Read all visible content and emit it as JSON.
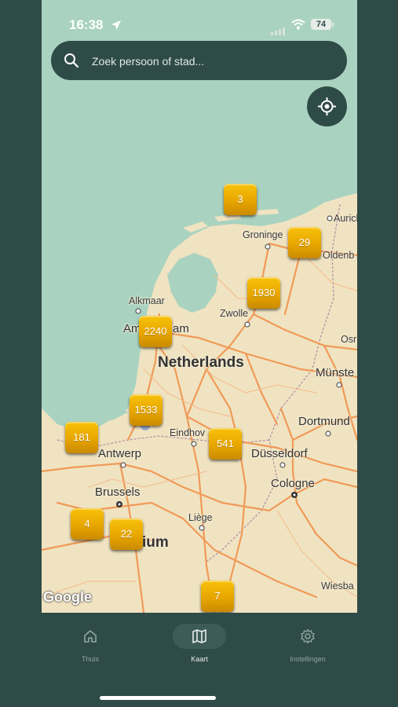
{
  "status_bar": {
    "time": "16:38",
    "battery": "74"
  },
  "search": {
    "placeholder": "Zoek persoon of stad..."
  },
  "map": {
    "attribution": "Google",
    "country_labels": {
      "netherlands": "Netherlands",
      "belgium_partial": "ium"
    },
    "city_labels": {
      "aurich": "Aurich",
      "groningen": "Groninge",
      "oldenburg": "Oldenb",
      "alkmaar": "Alkmaar",
      "amsterdam_left": "Am",
      "amsterdam_right": "am",
      "zwolle": "Zwolle",
      "osnabruck": "Osr",
      "munster": "Münste",
      "dortmund": "Dortmund",
      "eindhoven": "Eindhov",
      "antwerp": "Antwerp",
      "dusseldorf": "Düsseldorf",
      "cologne": "Cologne",
      "brussels": "Brussels",
      "liege": "Liège",
      "wiesbaden": "Wiesba"
    },
    "clusters": [
      {
        "count": "3"
      },
      {
        "count": "29"
      },
      {
        "count": "1930"
      },
      {
        "count": "2240"
      },
      {
        "count": "1533"
      },
      {
        "count": "181"
      },
      {
        "count": "541"
      },
      {
        "count": "4"
      },
      {
        "count": "22"
      },
      {
        "count": "7"
      }
    ]
  },
  "tabbar": {
    "tabs": [
      {
        "label": "Thuis",
        "icon": "home-icon"
      },
      {
        "label": "Kaart",
        "icon": "map-icon",
        "active": true
      },
      {
        "label": "Instellingen",
        "icon": "gear-icon"
      }
    ]
  },
  "colors": {
    "theme": "#2f4b47",
    "cluster": "#e8a600",
    "water": "#a9d3c0",
    "land": "#f0e3c1"
  }
}
